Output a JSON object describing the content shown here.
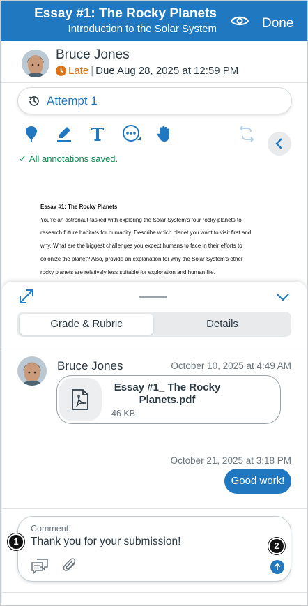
{
  "header": {
    "title": "Essay #1: The Rocky Planets",
    "subtitle": "Introduction to the Solar System",
    "done_label": "Done",
    "background": "#2079c0",
    "eye_icon": "eye-icon"
  },
  "student": {
    "name": "Bruce Jones",
    "late_label": "Late",
    "separator": "|",
    "due": "Due Aug 28, 2025 at 12:59 PM",
    "late_color": "#d97316"
  },
  "attempt": {
    "label": "Attempt 1"
  },
  "toolbar": {
    "icons": [
      "pin-icon",
      "highlighter-icon",
      "text-icon",
      "more-icon",
      "hand-icon",
      "undo-redo-icon",
      "chevron-left-icon"
    ]
  },
  "annotations_status": {
    "check": "✓",
    "text": "All annotations saved.",
    "color": "#0b874b"
  },
  "document": {
    "title": "Essay #1: The Rocky Planets",
    "lines": [
      "You're an astronaut tasked with exploring the Solar System's four rocky planets to",
      "research future habitats for humanity. Describe which planet you want to visit first and",
      "why. What are the biggest challenges you expect humans to face in their efforts to",
      "colonize the planet? Also, provide an explanation for why the Solar System's other",
      "rocky planets are relatively less suitable for exploration and human life."
    ]
  },
  "panel": {
    "tabs": [
      {
        "label": "Grade & Rubric",
        "active": true
      },
      {
        "label": "Details",
        "active": false
      }
    ]
  },
  "comments": {
    "submission": {
      "author": "Bruce Jones",
      "date": "October 10, 2025 at 4:49 AM",
      "file_name": "Essay #1_ The Rocky Planets.pdf",
      "file_size": "46 KB"
    },
    "reply": {
      "date": "October 21, 2025 at 3:18 PM",
      "text": "Good work!"
    }
  },
  "composer": {
    "placeholder": "Comment",
    "value": "Thank you for your submission!",
    "callouts": [
      "1",
      "2"
    ]
  }
}
